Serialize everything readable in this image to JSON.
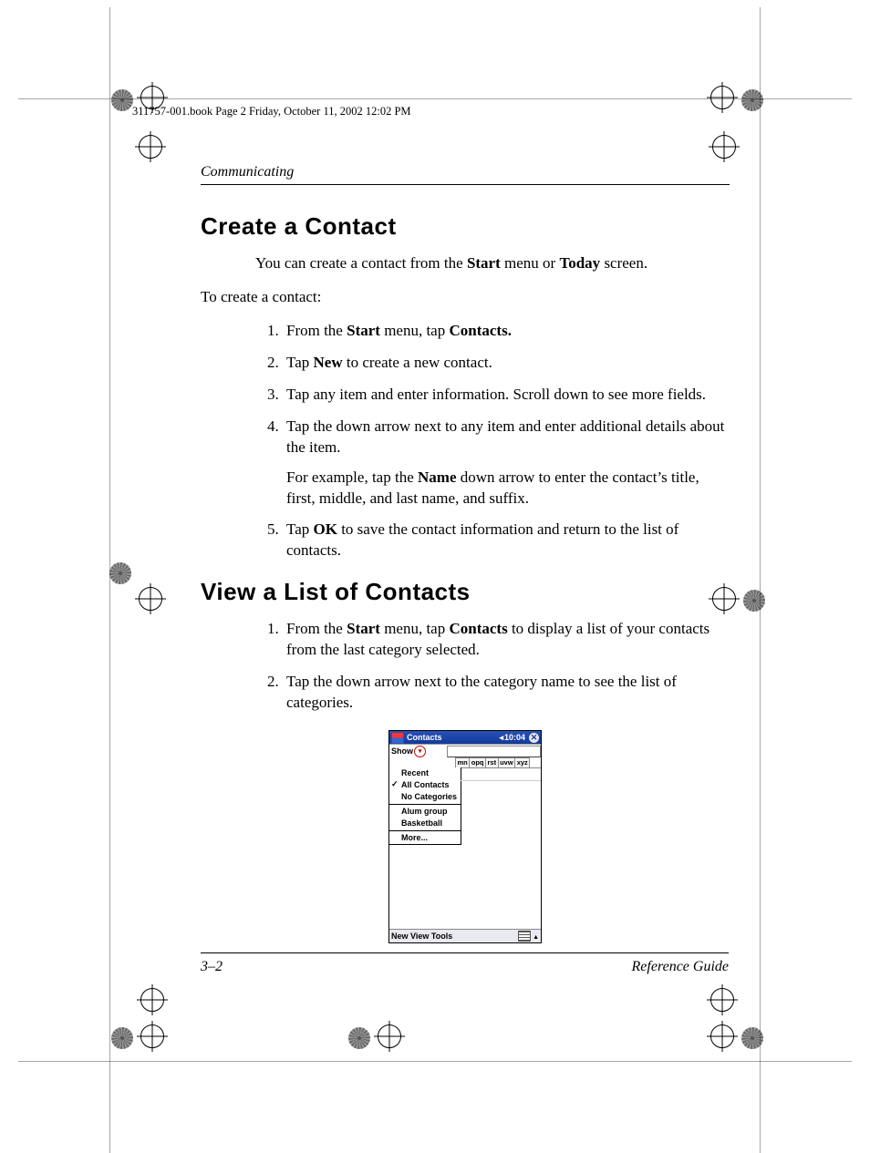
{
  "meta_line": "311757-001.book  Page 2  Friday, October 11, 2002  12:02 PM",
  "running_head": "Communicating",
  "page_num": "3–2",
  "footer_right": "Reference Guide",
  "section1": {
    "title": "Create a Contact",
    "intro_a": "You can create a contact from the ",
    "intro_b": " menu or ",
    "intro_c": " screen.",
    "start": "Start",
    "today": "Today",
    "lead": "To create a contact:",
    "steps": [
      {
        "parts": [
          "From the ",
          "Start",
          " menu, tap ",
          "Contacts.",
          ""
        ]
      },
      {
        "parts": [
          "Tap ",
          "New",
          " to create a new contact."
        ]
      },
      {
        "plain": "Tap any item and enter information. Scroll down to see more fields."
      },
      {
        "plain": "Tap the down arrow next to any item and enter additional details about the item.",
        "sub_a": "For example, tap the ",
        "sub_bold": "Name",
        "sub_b": " down arrow to enter the contact’s title, first, middle, and last name, and suffix."
      },
      {
        "parts": [
          "Tap ",
          "OK",
          " to save the contact information and return to the list of contacts."
        ]
      }
    ]
  },
  "section2": {
    "title": "View a List of Contacts",
    "steps": [
      {
        "parts": [
          "From the ",
          "Start",
          " menu, tap ",
          "Contacts",
          " to display a list of your contacts from the last category selected."
        ]
      },
      {
        "plain": "Tap the down arrow next to the category name to see the list of categories."
      }
    ]
  },
  "ppc": {
    "title": "Contacts",
    "time": "10:04",
    "show": "Show",
    "tabs": [
      "mn",
      "opq",
      "rst",
      "uvw",
      "xyz"
    ],
    "cats": [
      "Recent",
      "All Contacts",
      "No Categories",
      "Alum group",
      "Basketball",
      "More..."
    ],
    "menu": [
      "New",
      "View",
      "Tools"
    ]
  }
}
